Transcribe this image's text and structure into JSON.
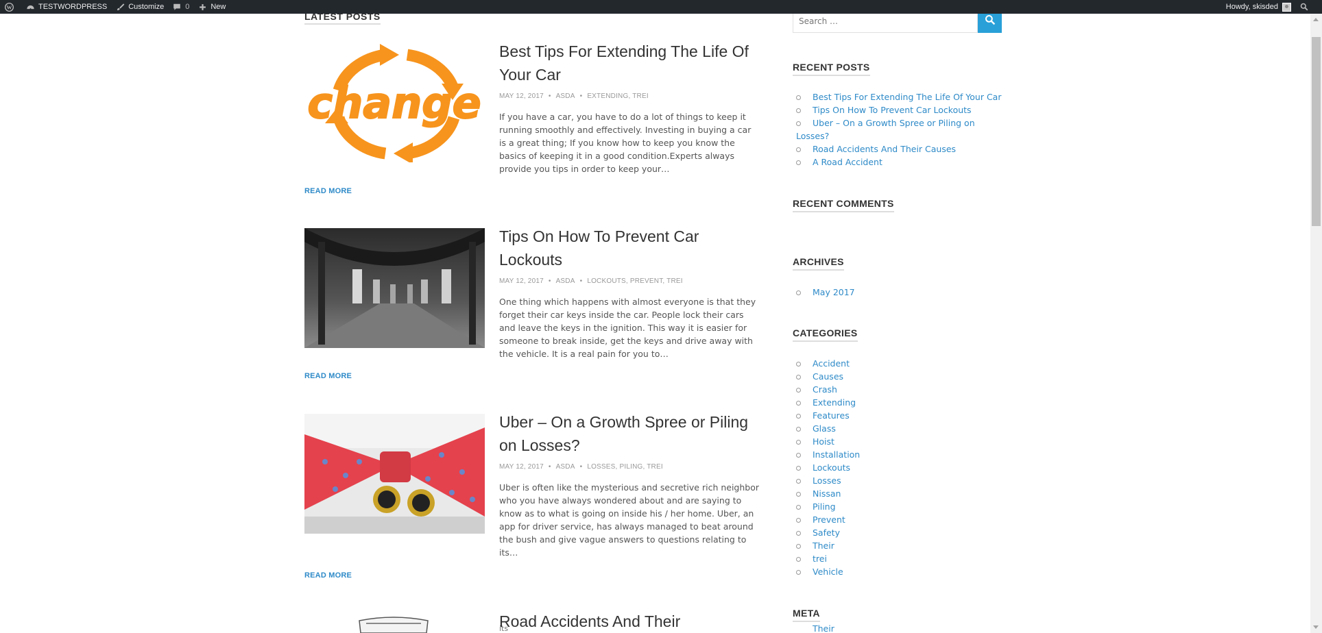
{
  "adminbar": {
    "site_name": "TESTWORDPRESS",
    "customize": "Customize",
    "comments_count": "0",
    "new_label": "New",
    "greeting": "Howdy, skisded"
  },
  "main": {
    "section_title": "LATEST POSTS",
    "read_more": "READ MORE",
    "posts": [
      {
        "title": "Best Tips For Extending The Life Of Your Car",
        "date": "MAY 12, 2017",
        "author": "ASDA",
        "categories": "EXTENDING, TREI",
        "excerpt": "If you have a car, you have to do a lot of things to keep it running smoothly and effectively. Investing in buying a car is a great thing; If you know how to keep you know the basics of keeping it in a good condition.Experts always provide you tips in order to keep your…",
        "image_word": "change"
      },
      {
        "title": "Tips On How To Prevent Car Lockouts",
        "date": "MAY 12, 2017",
        "author": "ASDA",
        "categories": "LOCKOUTS, PREVENT, TREI",
        "excerpt": "One thing which happens with almost everyone is that they forget their car keys inside the car. People lock their cars and leave the keys in the ignition. This way it is easier for someone to break inside, get the keys and drive away with the vehicle. It is a real pain for you to…"
      },
      {
        "title": "Uber – On a Growth Spree or Piling on Losses?",
        "date": "MAY 12, 2017",
        "author": "ASDA",
        "categories": "LOSSES, PILING, TREI",
        "excerpt": "Uber is often like the mysterious and secretive rich neighbor who you have always wondered about and are saying to know as to what is going on inside his / her home. Uber, an app for driver service, has always managed to beat around the bush and give vague answers to questions relating to its…"
      },
      {
        "title": "Road Accidents And Their",
        "partial_below": "its"
      }
    ]
  },
  "sidebar": {
    "search_placeholder": "Search …",
    "recent_posts_title": "RECENT POSTS",
    "recent_posts": [
      "Best Tips For Extending The Life Of Your Car",
      "Tips On How To Prevent Car Lockouts",
      "Uber – On a Growth Spree or Piling on Losses?",
      "Road Accidents And Their Causes",
      "A Road Accident"
    ],
    "recent_comments_title": "RECENT COMMENTS",
    "archives_title": "ARCHIVES",
    "archives": [
      "May 2017"
    ],
    "categories_title": "CATEGORIES",
    "categories": [
      "Accident",
      "Causes",
      "Crash",
      "Extending",
      "Features",
      "Glass",
      "Hoist",
      "Installation",
      "Lockouts",
      "Losses",
      "Nissan",
      "Piling",
      "Prevent",
      "Safety",
      "Their",
      "trei",
      "Vehicle"
    ],
    "meta_title": "META",
    "meta_partial": "Their"
  },
  "colors": {
    "adminbar_bg": "#23282d",
    "link": "#2e8ac8",
    "search_button": "#29a0d8",
    "change_orange": "#f7941d"
  }
}
